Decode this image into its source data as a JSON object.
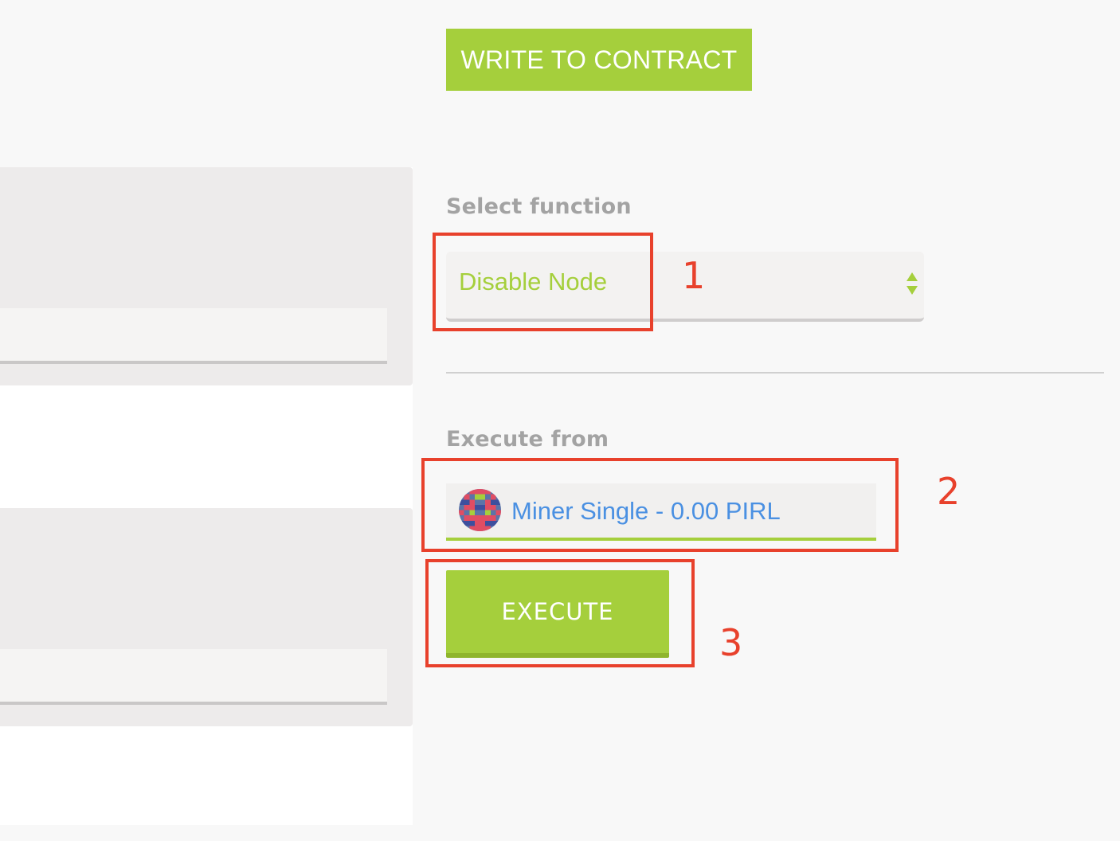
{
  "header": {
    "write_button_label": "WRITE TO CONTRACT"
  },
  "function_select": {
    "label": "Select function",
    "value": "Disable Node"
  },
  "execute_from": {
    "label": "Execute from",
    "account": "Miner Single - 0.00 PIRL"
  },
  "actions": {
    "execute_label": "EXECUTE"
  },
  "annotations": {
    "step1": "1",
    "step2": "2",
    "step3": "3"
  },
  "colors": {
    "accent_green": "#a5cf3c",
    "annotation_red": "#e8412c",
    "account_blue": "#4a90e2",
    "label_gray": "#a3a3a3"
  },
  "icons": {
    "select_arrows": "up-down-arrows-icon",
    "avatar": "identicon-avatar"
  }
}
